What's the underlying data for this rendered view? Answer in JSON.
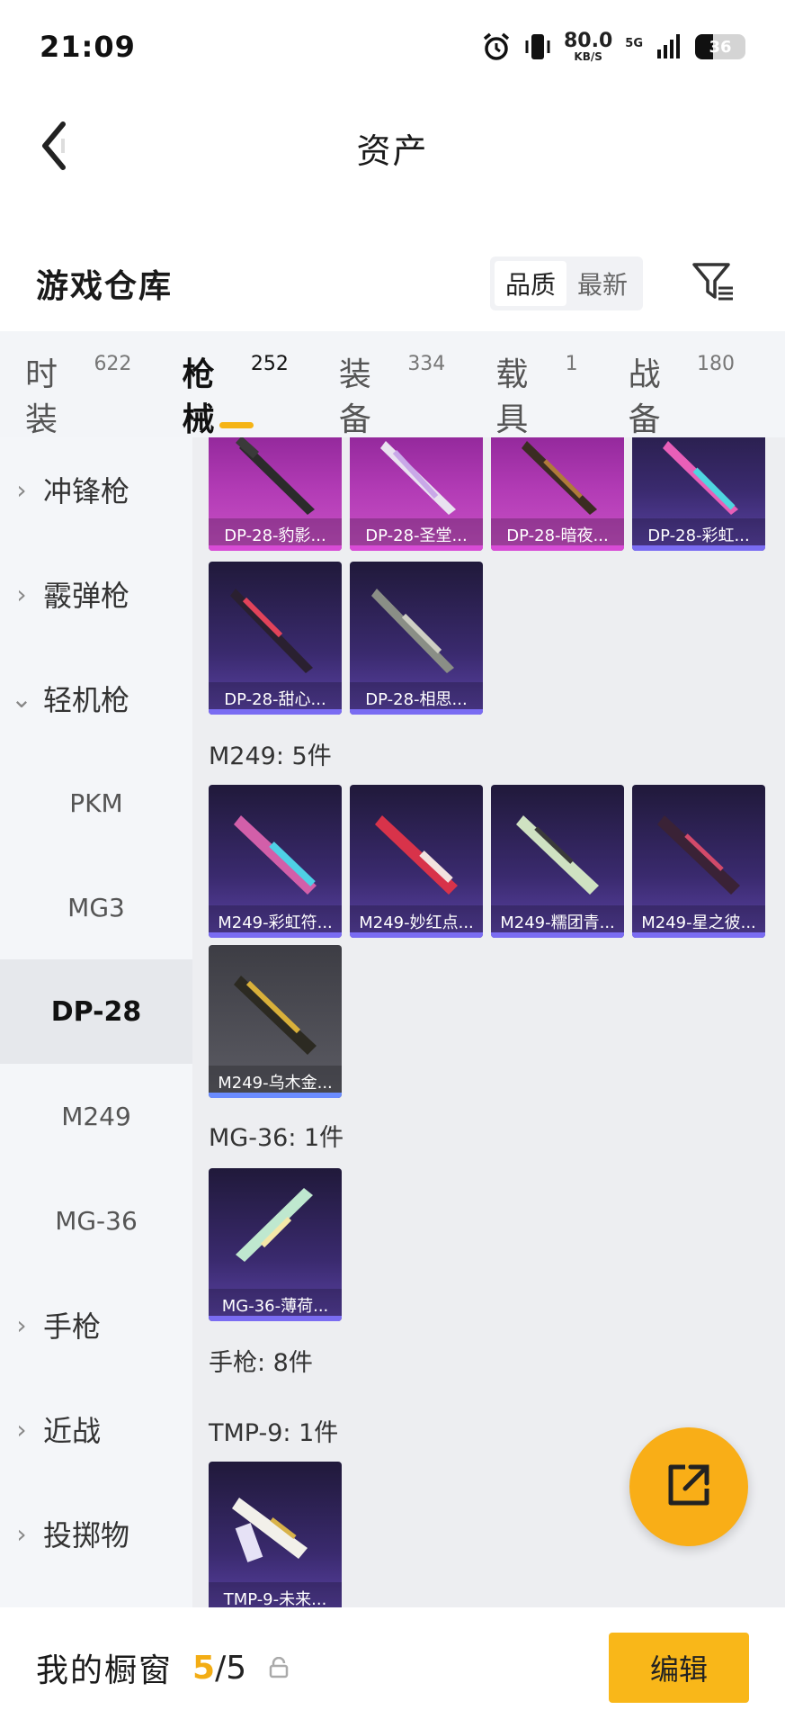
{
  "status_bar": {
    "time": "21:09",
    "speed_value": "80.0",
    "speed_unit": "KB/S",
    "network": "5G",
    "battery": "36",
    "battery_level": 0.36
  },
  "header": {
    "title": "资产",
    "back_icon": "chevron-left-icon"
  },
  "warehouse": {
    "title": "游戏仓库",
    "sort_options": [
      "品质",
      "最新"
    ],
    "active_sort": "品质",
    "filter_icon": "filter-icon"
  },
  "tabs": [
    {
      "label": "时装",
      "count": "622"
    },
    {
      "label": "枪械",
      "count": "252"
    },
    {
      "label": "装备",
      "count": "334"
    },
    {
      "label": "载具",
      "count": "1"
    },
    {
      "label": "战备",
      "count": "180"
    }
  ],
  "active_tab": "枪械",
  "sidebar": {
    "items": [
      {
        "label": "冲锋枪",
        "type": "category",
        "expanded": false
      },
      {
        "label": "霰弹枪",
        "type": "category",
        "expanded": false
      },
      {
        "label": "轻机枪",
        "type": "category",
        "expanded": true
      },
      {
        "label": "PKM",
        "type": "sub"
      },
      {
        "label": "MG3",
        "type": "sub"
      },
      {
        "label": "DP-28",
        "type": "sub",
        "selected": true
      },
      {
        "label": "M249",
        "type": "sub"
      },
      {
        "label": "MG-36",
        "type": "sub"
      },
      {
        "label": "手枪",
        "type": "category",
        "expanded": false
      },
      {
        "label": "近战",
        "type": "category",
        "expanded": false
      },
      {
        "label": "投掷物",
        "type": "category",
        "expanded": false
      }
    ]
  },
  "content": {
    "dp28_row1": [
      "DP-28-豹影...",
      "DP-28-圣堂...",
      "DP-28-暗夜...",
      "DP-28-彩虹..."
    ],
    "dp28_row2": [
      "DP-28-甜心...",
      "DP-28-相思..."
    ],
    "m249_label": "M249: 5件",
    "m249_items": [
      "M249-彩虹符...",
      "M249-妙红点...",
      "M249-糯团青...",
      "M249-星之彼...",
      "M249-乌木金..."
    ],
    "mg36_label": "MG-36: 1件",
    "mg36_items": [
      "MG-36-薄荷..."
    ],
    "pistol_label": "手枪: 8件",
    "tmp9_label": "TMP-9: 1件",
    "tmp9_items": [
      "TMP-9-未来..."
    ]
  },
  "fab": {
    "icon": "share-external-icon"
  },
  "bottom": {
    "title": "我的橱窗",
    "current": "5",
    "separator": "/",
    "max": "5",
    "lock_icon": "lock-icon",
    "edit_label": "编辑"
  },
  "colors": {
    "accent": "#f9b719",
    "tab_underline": "#f5b416",
    "legendary_pink": "#b23bb5",
    "epic_purple": "#3a2a6e"
  }
}
